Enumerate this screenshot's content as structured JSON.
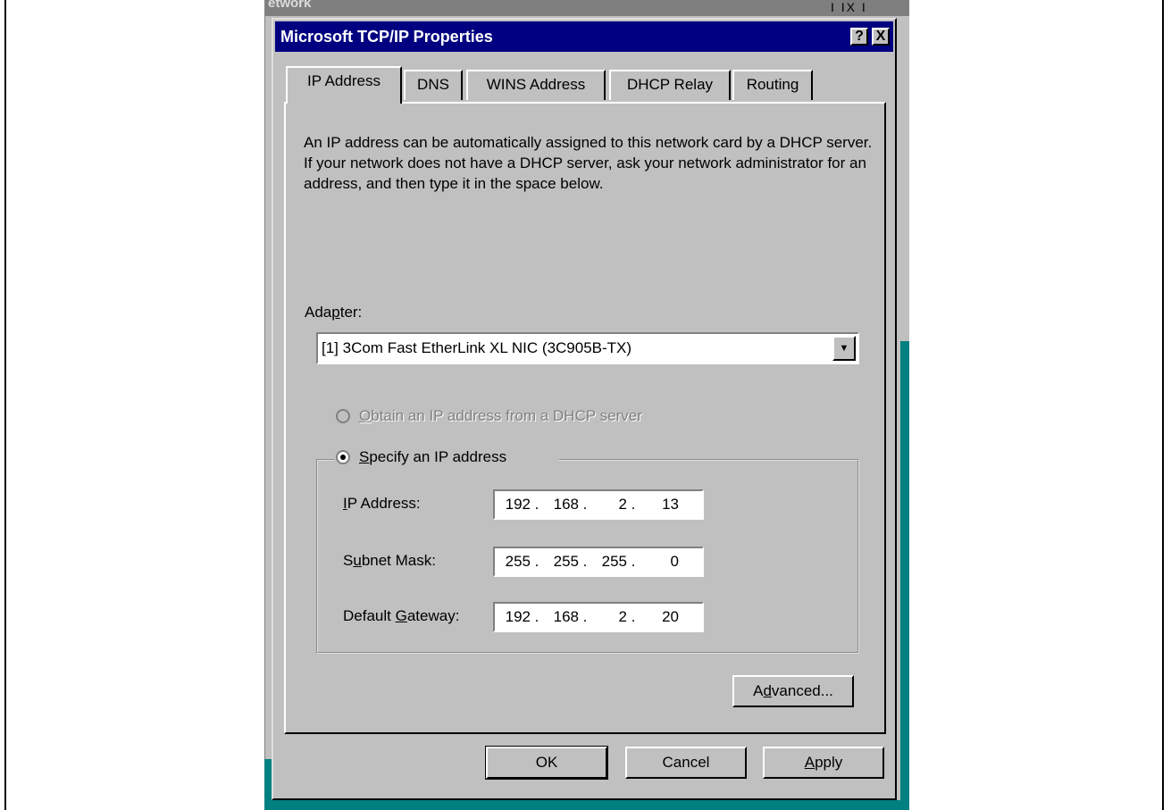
{
  "background_window": {
    "title_fragment": "etwork",
    "title_buttons": "I IX I"
  },
  "dialog": {
    "title": "Microsoft TCP/IP Properties",
    "help_button": "?",
    "close_button": "X"
  },
  "tabs": [
    {
      "label": "IP Address",
      "active": true
    },
    {
      "label": "DNS",
      "active": false
    },
    {
      "label": "WINS Address",
      "active": false
    },
    {
      "label": "DHCP Relay",
      "active": false
    },
    {
      "label": "Routing",
      "active": false
    }
  ],
  "description": "An IP address can be automatically assigned to this network card by a DHCP server.  If your network does not have a DHCP server, ask your network administrator for an address, and then type it in the space below.",
  "adapter": {
    "label_pre": "Ada",
    "label_accel": "p",
    "label_post": "ter:",
    "selected": "[1] 3Com Fast EtherLink XL NIC (3C905B-TX)"
  },
  "options": {
    "dhcp": {
      "accel": "O",
      "rest": "btain an IP address from a DHCP server",
      "enabled": false,
      "checked": false
    },
    "specify": {
      "accel": "S",
      "rest": "pecify an IP address",
      "enabled": true,
      "checked": true
    }
  },
  "fields": {
    "ip_address": {
      "label_pre": "",
      "label_accel": "I",
      "label_post": "P Address:",
      "octets": [
        "192",
        "168",
        "2",
        "13"
      ]
    },
    "subnet_mask": {
      "label_pre": "S",
      "label_accel": "u",
      "label_post": "bnet Mask:",
      "octets": [
        "255",
        "255",
        "255",
        "0"
      ]
    },
    "default_gateway": {
      "label_pre": "Default ",
      "label_accel": "G",
      "label_post": "ateway:",
      "octets": [
        "192",
        "168",
        "2",
        "20"
      ]
    }
  },
  "buttons": {
    "advanced": {
      "pre": "A",
      "accel": "d",
      "post": "vanced..."
    },
    "ok": "OK",
    "cancel": "Cancel",
    "apply": {
      "accel": "A",
      "post": "pply"
    }
  }
}
